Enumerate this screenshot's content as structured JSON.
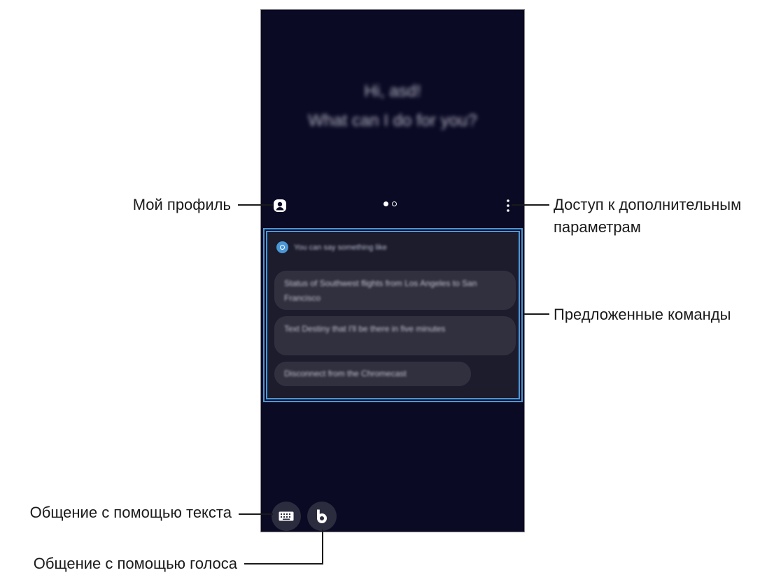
{
  "screen": {
    "greeting_line1": "Hi, asd!",
    "greeting_line2": "What can I do for you?",
    "suggestions_header": "You can say something like",
    "suggestions": [
      "Status of Southwest flights from Los Angeles to San Francisco",
      "Text Destiny that I'll be there in five minutes",
      "Disconnect from the Chromecast"
    ],
    "page_indicator": {
      "current": 1,
      "total": 2
    },
    "icons": {
      "profile": "profile-icon",
      "more": "more-options-icon",
      "keyboard": "keyboard-icon",
      "voice": "bixby-icon",
      "suggestion_header": "bixby-icon"
    },
    "colors": {
      "background": "#0b0a24",
      "panel": "#1c1c2d",
      "chip": "#30303f",
      "highlight": "#4a97d6"
    }
  },
  "annotations": {
    "profile": "Мой профиль",
    "more_line1": "Доступ к дополнительным",
    "more_line2": "параметрам",
    "suggestions": "Предложенные команды",
    "text_chat": "Общение с помощью текста",
    "voice_chat": "Общение с помощью голоса"
  }
}
